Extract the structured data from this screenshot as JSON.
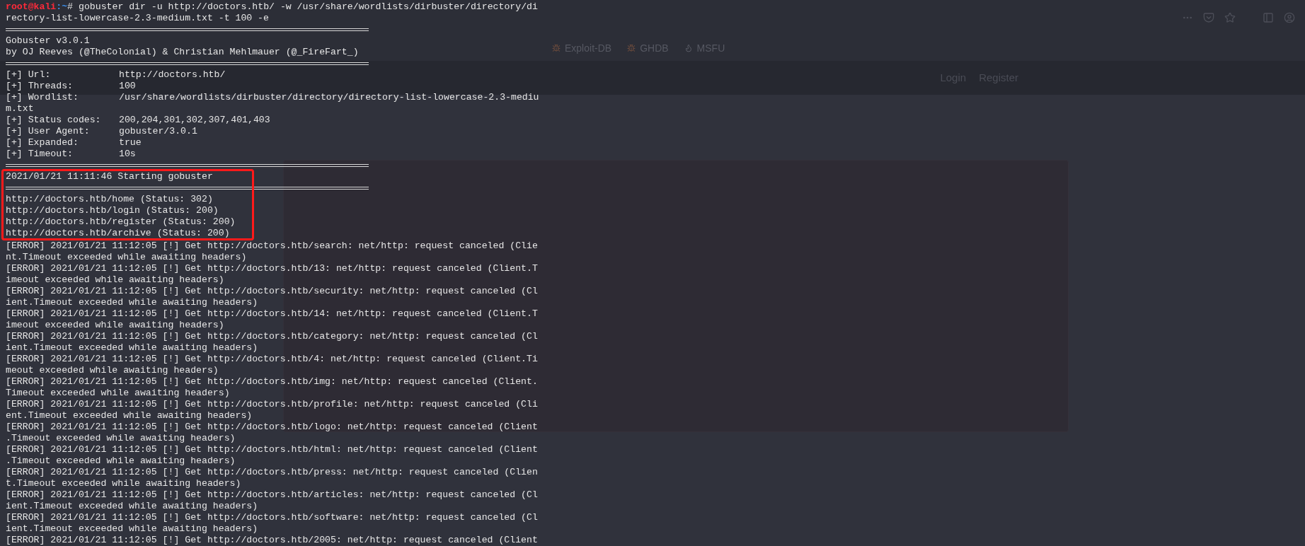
{
  "browser": {
    "bookmarks": [
      {
        "label": "Exploit-DB",
        "kind": "bug"
      },
      {
        "label": "GHDB",
        "kind": "bug"
      },
      {
        "label": "MSFU",
        "kind": "dragon"
      }
    ],
    "nav_links": [
      "Login",
      "Register"
    ]
  },
  "terminal": {
    "lines": [
      {
        "kind": "prompt",
        "user_host": "root@kali",
        "path": ":~",
        "symbol": "#",
        "command": "gobuster dir -u http://doctors.htb/ -w /usr/share/wordlists/dirbuster/directory/di"
      },
      {
        "kind": "text",
        "text": "rectory-list-lowercase-2.3-medium.txt -t 100 -e"
      },
      {
        "kind": "rule"
      },
      {
        "kind": "text",
        "text": "Gobuster v3.0.1"
      },
      {
        "kind": "text",
        "text": "by OJ Reeves (@TheColonial) & Christian Mehlmauer (@_FireFart_)"
      },
      {
        "kind": "rule"
      },
      {
        "kind": "field",
        "label": "[+] Url:",
        "value": "http://doctors.htb/"
      },
      {
        "kind": "field",
        "label": "[+] Threads:",
        "value": "100"
      },
      {
        "kind": "field",
        "label": "[+] Wordlist:",
        "value": "/usr/share/wordlists/dirbuster/directory/directory-list-lowercase-2.3-mediu"
      },
      {
        "kind": "text",
        "text": "m.txt"
      },
      {
        "kind": "field",
        "label": "[+] Status codes:",
        "value": "200,204,301,302,307,401,403"
      },
      {
        "kind": "field",
        "label": "[+] User Agent:",
        "value": "gobuster/3.0.1"
      },
      {
        "kind": "field",
        "label": "[+] Expanded:",
        "value": "true"
      },
      {
        "kind": "field",
        "label": "[+] Timeout:",
        "value": "10s"
      },
      {
        "kind": "rule"
      },
      {
        "kind": "boxed",
        "lines": [
          {
            "kind": "text",
            "text": "2021/01/21 11:11:46 Starting gobuster"
          },
          {
            "kind": "rule"
          },
          {
            "kind": "text",
            "text": "http://doctors.htb/home (Status: 302)"
          },
          {
            "kind": "text",
            "text": "http://doctors.htb/login (Status: 200)"
          },
          {
            "kind": "text",
            "text": "http://doctors.htb/register (Status: 200)"
          },
          {
            "kind": "text",
            "text": "http://doctors.htb/archive (Status: 200)"
          }
        ]
      },
      {
        "kind": "text",
        "text": "[ERROR] 2021/01/21 11:12:05 [!] Get http://doctors.htb/search: net/http: request canceled (Clie"
      },
      {
        "kind": "text",
        "text": "nt.Timeout exceeded while awaiting headers)"
      },
      {
        "kind": "text",
        "text": "[ERROR] 2021/01/21 11:12:05 [!] Get http://doctors.htb/13: net/http: request canceled (Client.T"
      },
      {
        "kind": "text",
        "text": "imeout exceeded while awaiting headers)"
      },
      {
        "kind": "text",
        "text": "[ERROR] 2021/01/21 11:12:05 [!] Get http://doctors.htb/security: net/http: request canceled (Cl"
      },
      {
        "kind": "text",
        "text": "ient.Timeout exceeded while awaiting headers)"
      },
      {
        "kind": "text",
        "text": "[ERROR] 2021/01/21 11:12:05 [!] Get http://doctors.htb/14: net/http: request canceled (Client.T"
      },
      {
        "kind": "text",
        "text": "imeout exceeded while awaiting headers)"
      },
      {
        "kind": "text",
        "text": "[ERROR] 2021/01/21 11:12:05 [!] Get http://doctors.htb/category: net/http: request canceled (Cl"
      },
      {
        "kind": "text",
        "text": "ient.Timeout exceeded while awaiting headers)"
      },
      {
        "kind": "text",
        "text": "[ERROR] 2021/01/21 11:12:05 [!] Get http://doctors.htb/4: net/http: request canceled (Client.Ti"
      },
      {
        "kind": "text",
        "text": "meout exceeded while awaiting headers)"
      },
      {
        "kind": "text",
        "text": "[ERROR] 2021/01/21 11:12:05 [!] Get http://doctors.htb/img: net/http: request canceled (Client."
      },
      {
        "kind": "text",
        "text": "Timeout exceeded while awaiting headers)"
      },
      {
        "kind": "text",
        "text": "[ERROR] 2021/01/21 11:12:05 [!] Get http://doctors.htb/profile: net/http: request canceled (Cli"
      },
      {
        "kind": "text",
        "text": "ent.Timeout exceeded while awaiting headers)"
      },
      {
        "kind": "text",
        "text": "[ERROR] 2021/01/21 11:12:05 [!] Get http://doctors.htb/logo: net/http: request canceled (Client"
      },
      {
        "kind": "text",
        "text": ".Timeout exceeded while awaiting headers)"
      },
      {
        "kind": "text",
        "text": "[ERROR] 2021/01/21 11:12:05 [!] Get http://doctors.htb/html: net/http: request canceled (Client"
      },
      {
        "kind": "text",
        "text": ".Timeout exceeded while awaiting headers)"
      },
      {
        "kind": "text",
        "text": "[ERROR] 2021/01/21 11:12:05 [!] Get http://doctors.htb/press: net/http: request canceled (Clien"
      },
      {
        "kind": "text",
        "text": "t.Timeout exceeded while awaiting headers)"
      },
      {
        "kind": "text",
        "text": "[ERROR] 2021/01/21 11:12:05 [!] Get http://doctors.htb/articles: net/http: request canceled (Cl"
      },
      {
        "kind": "text",
        "text": "ient.Timeout exceeded while awaiting headers)"
      },
      {
        "kind": "text",
        "text": "[ERROR] 2021/01/21 11:12:05 [!] Get http://doctors.htb/software: net/http: request canceled (Cl"
      },
      {
        "kind": "text",
        "text": "ient.Timeout exceeded while awaiting headers)"
      },
      {
        "kind": "text",
        "text": "[ERROR] 2021/01/21 11:12:05 [!] Get http://doctors.htb/2005: net/http: request canceled (Client"
      }
    ]
  }
}
